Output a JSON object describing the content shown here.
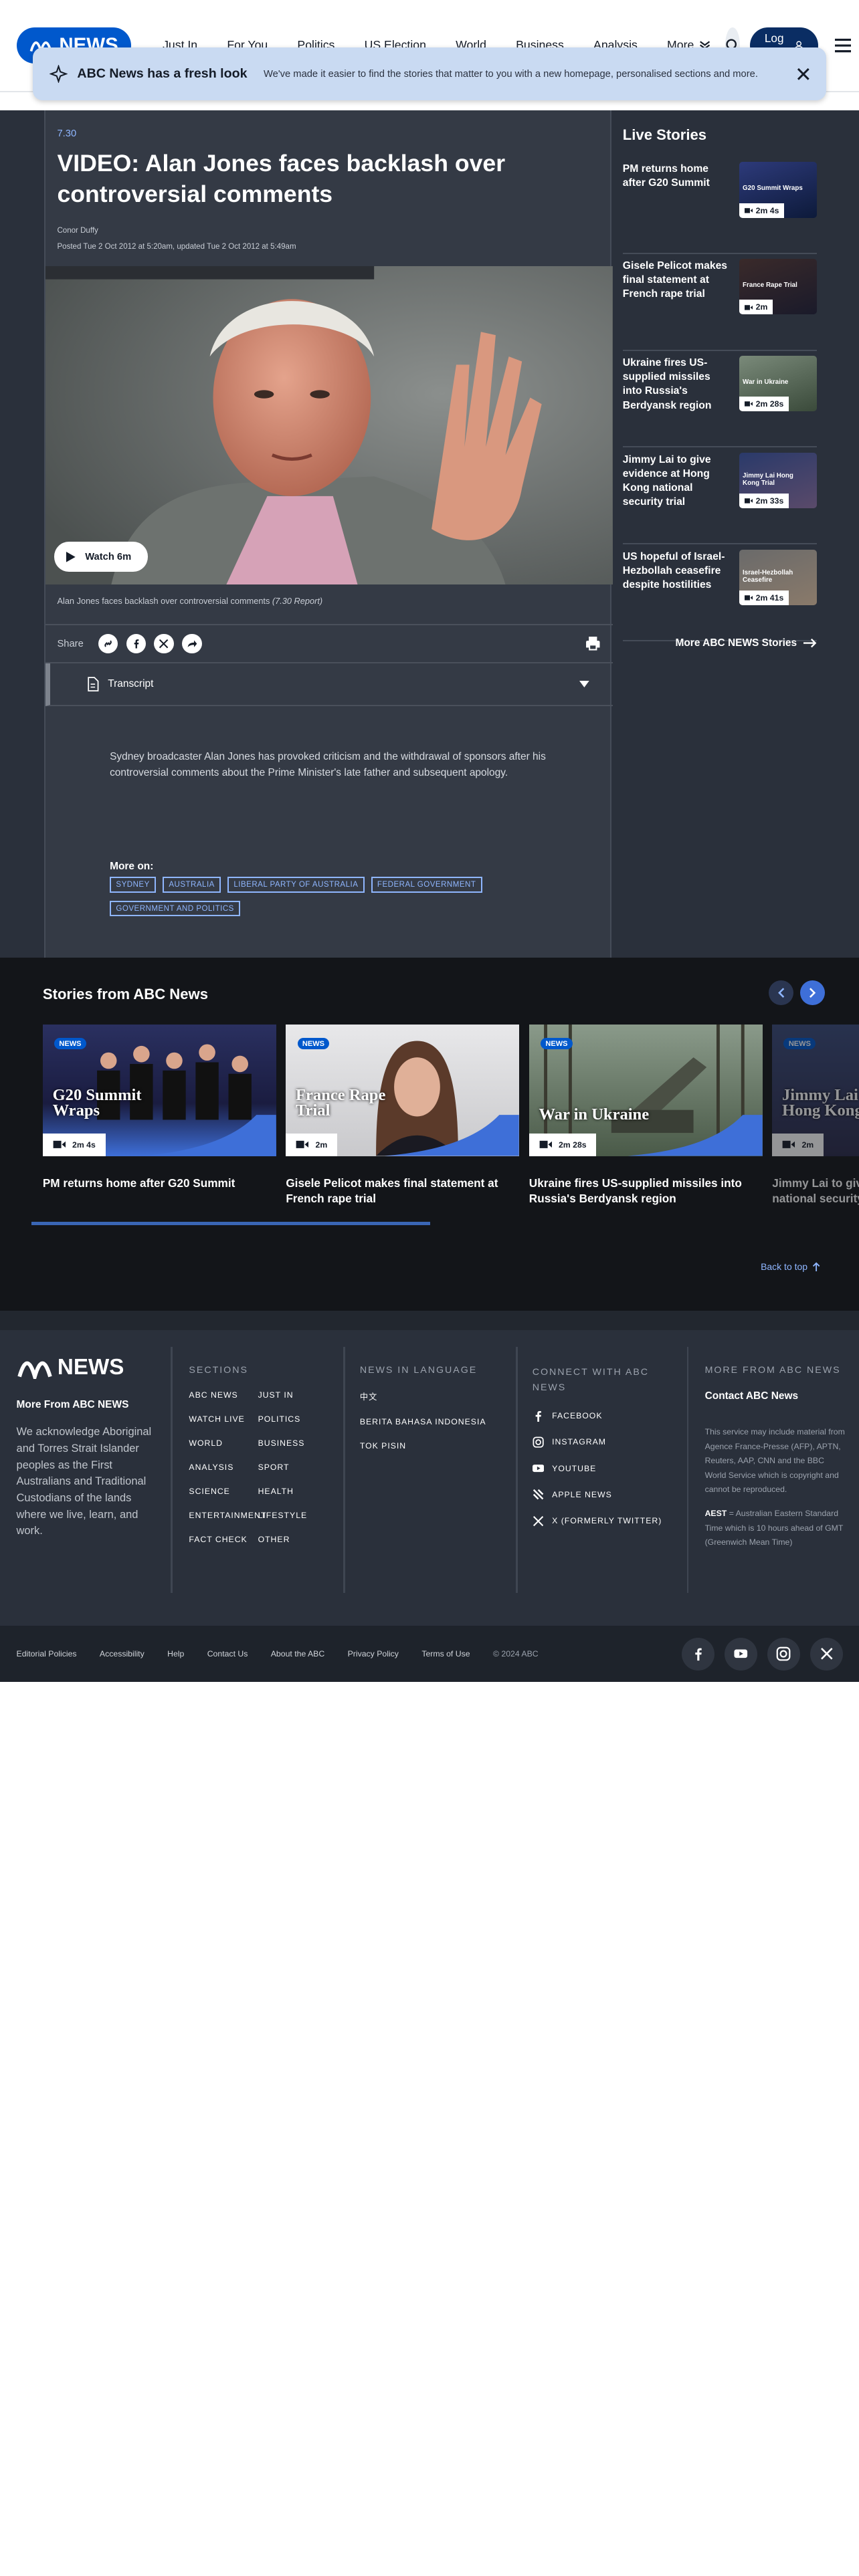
{
  "header": {
    "logo": "NEWS",
    "nav": [
      "Just In",
      "For You",
      "Politics",
      "US Election",
      "World",
      "Business",
      "Analysis"
    ],
    "more": "More",
    "login": "Log in"
  },
  "banner": {
    "title": "ABC News has a fresh look",
    "text": "We've made it easier to find the stories that matter to you with a new homepage, personalised sections and more."
  },
  "article": {
    "program": "7.30",
    "title": "VIDEO: Alan Jones faces backlash over controversial comments",
    "author": "Conor Duffy",
    "posted": "Posted Tue 2 Oct 2012 at 5:20am, updated Tue 2 Oct 2012 at 5:49am",
    "watch": "Watch 6m",
    "caption": "Alan Jones faces backlash over controversial comments",
    "caption_source": "(7.30 Report)",
    "share": "Share",
    "transcript": "Transcript",
    "body": "Sydney broadcaster Alan Jones has provoked criticism and the withdrawal of sponsors after his controversial comments about the Prime Minister's late father and subsequent apology.",
    "more_on": "More on:",
    "tags": [
      "SYDNEY",
      "AUSTRALIA",
      "LIBERAL PARTY OF AUSTRALIA",
      "FEDERAL GOVERNMENT",
      "GOVERNMENT AND POLITICS"
    ]
  },
  "live": {
    "heading": "Live Stories",
    "items": [
      {
        "title": "PM returns home after G20 Summit",
        "duration": "2m 4s",
        "thumb_label": "G20 Summit Wraps"
      },
      {
        "title": "Gisele Pelicot makes final statement at French rape trial",
        "duration": "2m",
        "thumb_label": "France Rape Trial"
      },
      {
        "title": "Ukraine fires US-supplied missiles into Russia's Berdyansk region",
        "duration": "2m 28s",
        "thumb_label": "War in Ukraine"
      },
      {
        "title": "Jimmy Lai to give evidence at Hong Kong national security trial",
        "duration": "2m 33s",
        "thumb_label": "Jimmy Lai Hong Kong Trial"
      },
      {
        "title": "US hopeful of Israel-Hezbollah ceasefire despite hostilities",
        "duration": "2m 41s",
        "thumb_label": "Israel-Hezbollah Ceasefire"
      }
    ],
    "more": "More ABC NEWS Stories"
  },
  "stories": {
    "heading": "Stories from ABC News",
    "cards": [
      {
        "title": "PM returns home after G20 Summit",
        "overlay": "G20 Summit Wraps",
        "duration": "2m 4s",
        "badge": "NEWS"
      },
      {
        "title": "Gisele Pelicot makes final statement at French rape trial",
        "overlay": "France Rape Trial",
        "duration": "2m",
        "badge": "NEWS"
      },
      {
        "title": "Ukraine fires US-supplied missiles into Russia's Berdyansk region",
        "overlay": "War in Ukraine",
        "duration": "2m 28s",
        "badge": "NEWS"
      },
      {
        "title": "Jimmy Lai to give evidence at Hong Kong national security trial",
        "overlay": "Jimmy Lai Hong Kong",
        "duration": "2m",
        "badge": "NEWS"
      }
    ],
    "back_to_top": "Back to top"
  },
  "footer": {
    "logo": "NEWS",
    "more_from": "More From ABC NEWS",
    "ack": "We acknowledge Aboriginal and Torres Strait Islander peoples as the First Australians and Traditional Custodians of the lands where we live, learn, and work.",
    "sections_head": "SECTIONS",
    "sections_a": [
      "ABC NEWS",
      "WATCH LIVE",
      "WORLD",
      "ANALYSIS",
      "SCIENCE",
      "ENTERTAINMENT",
      "FACT CHECK"
    ],
    "sections_b": [
      "JUST IN",
      "POLITICS",
      "BUSINESS",
      "SPORT",
      "HEALTH",
      "LIFESTYLE",
      "OTHER"
    ],
    "lang_head": "NEWS IN LANGUAGE",
    "langs": [
      "中文",
      "BERITA BAHASA INDONESIA",
      "TOK PISIN"
    ],
    "connect_head": "CONNECT WITH ABC NEWS",
    "connect": [
      "FACEBOOK",
      "INSTAGRAM",
      "YOUTUBE",
      "APPLE NEWS",
      "X (FORMERLY TWITTER)"
    ],
    "morefrom_head": "MORE FROM ABC NEWS",
    "contact": "Contact ABC News",
    "fine": "This service may include material from Agence France-Presse (AFP), APTN, Reuters, AAP, CNN and the BBC World Service which is copyright and cannot be reproduced.",
    "aest_label": "AEST",
    "aest": "= Australian Eastern Standard Time which is 10 hours ahead of GMT (Greenwich Mean Time)",
    "bottom": [
      "Editorial Policies",
      "Accessibility",
      "Help",
      "Contact Us",
      "About the ABC",
      "Privacy Policy",
      "Terms of Use",
      "© 2024 ABC"
    ]
  },
  "colors": {
    "brand": "#0058cc",
    "dark_bg": "#2a303b",
    "panel": "#343a45",
    "link": "#8fb6ff"
  }
}
